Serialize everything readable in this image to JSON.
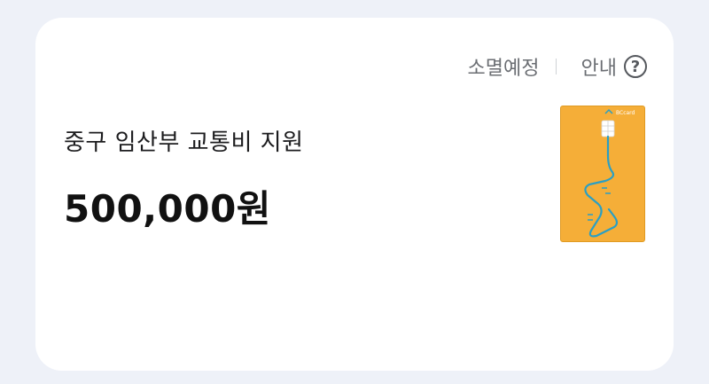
{
  "header": {
    "expiring_label": "소멸예정",
    "guide_label": "안내",
    "help_icon": "question-circle-icon"
  },
  "benefit": {
    "title": "중구 임산부 교통비 지원",
    "amount": "500,000원"
  },
  "card_image": {
    "brand_text": "BCcard",
    "colors": {
      "card": "#f5ae38",
      "line": "#2a9fc4"
    }
  }
}
